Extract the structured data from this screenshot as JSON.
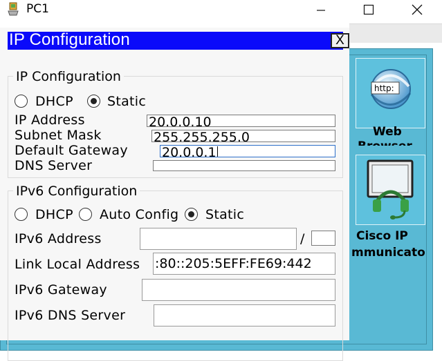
{
  "window": {
    "title": "PC1",
    "minimize_glyph": "—",
    "close_glyph": "✕"
  },
  "desktop_apps": [
    {
      "label": "Web",
      "label_line2": "Browser",
      "icon": "web-browser-http-icon",
      "icon_text": "http:"
    },
    {
      "label": "Cisco IP",
      "label_line2": "mmunicato",
      "icon": "cisco-ip-communicator-icon"
    }
  ],
  "dialog": {
    "title": "IP Configuration",
    "close_label": "X",
    "ipv4": {
      "group_title": "IP Configuration",
      "dhcp_label": "DHCP",
      "static_label": "Static",
      "selected": "static",
      "ip_address_label": "IP Address",
      "ip_address_value": "20.0.0.10",
      "subnet_mask_label": "Subnet Mask",
      "subnet_mask_value": "255.255.255.0",
      "default_gateway_label": "Default Gateway",
      "default_gateway_value": "20.0.0.1",
      "dns_server_label": "DNS Server",
      "dns_server_value": ""
    },
    "ipv6": {
      "group_title": "IPv6 Configuration",
      "dhcp_label": "DHCP",
      "auto_config_label": "Auto Config",
      "static_label": "Static",
      "selected": "static",
      "ipv6_address_label": "IPv6 Address",
      "ipv6_address_value": "",
      "prefix_separator": "/",
      "prefix_value": "",
      "link_local_label": "Link Local Address",
      "link_local_value": ":80::205:5EFF:FE69:442",
      "ipv6_gateway_label": "IPv6 Gateway",
      "ipv6_gateway_value": "",
      "ipv6_dns_label": "IPv6 DNS Server",
      "ipv6_dns_value": ""
    }
  },
  "colors": {
    "dialog_title_bar": "#0a0afa",
    "desktop_background": "#59b9d4",
    "dialog_background": "#f7f7f7"
  }
}
